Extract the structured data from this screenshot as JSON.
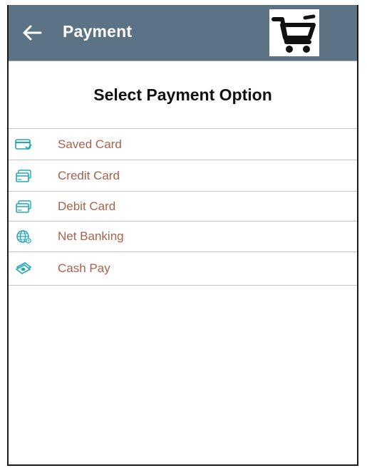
{
  "header": {
    "title": "Payment",
    "back_icon": "arrow-left-icon",
    "cart_icon": "shopping-cart-icon",
    "background_color": "#5b7384"
  },
  "page": {
    "title": "Select Payment Option"
  },
  "payment_options": [
    {
      "label": "Saved Card",
      "icon": "saved-card-icon"
    },
    {
      "label": "Credit Card",
      "icon": "credit-card-icon"
    },
    {
      "label": "Debit Card",
      "icon": "debit-card-icon"
    },
    {
      "label": "Net Banking",
      "icon": "globe-icon"
    },
    {
      "label": "Cash Pay",
      "icon": "cash-icon"
    }
  ],
  "colors": {
    "option_text": "#a5624a",
    "icon_accent": "#22a7b8"
  }
}
